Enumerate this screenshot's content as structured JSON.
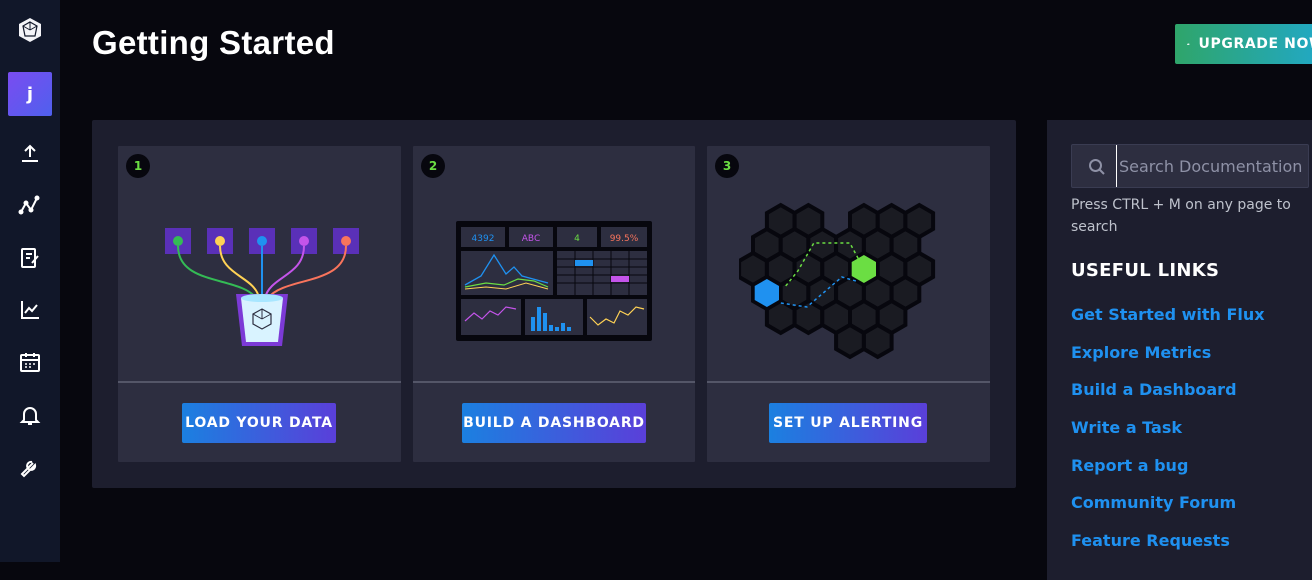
{
  "sidebar": {
    "avatar_initial": "j",
    "nav_icons": [
      "upload-icon",
      "graph-icon",
      "edit-note-icon",
      "chart-line-icon",
      "calendar-icon",
      "bell-icon",
      "wrench-icon"
    ]
  },
  "header": {
    "title": "Getting Started",
    "upgrade_label": "UPGRADE NOW"
  },
  "cards": [
    {
      "number": "1",
      "button": "LOAD YOUR DATA"
    },
    {
      "number": "2",
      "button": "BUILD A DASHBOARD",
      "stats": [
        "4392",
        "ABC",
        "4",
        "99.5%"
      ]
    },
    {
      "number": "3",
      "button": "SET UP ALERTING"
    }
  ],
  "search": {
    "placeholder": "Search Documentation",
    "value": "",
    "hint": "Press CTRL + M on any page to search"
  },
  "useful_links": {
    "title": "USEFUL LINKS",
    "items": [
      "Get Started with Flux",
      "Explore Metrics",
      "Build a Dashboard",
      "Write a Task",
      "Report a bug",
      "Community Forum",
      "Feature Requests"
    ]
  },
  "colors": {
    "accent_blue": "#1f91f0",
    "green": "#6bde43",
    "background": "#07070e",
    "panel": "#1d1e2e",
    "card": "#2d2e40"
  }
}
